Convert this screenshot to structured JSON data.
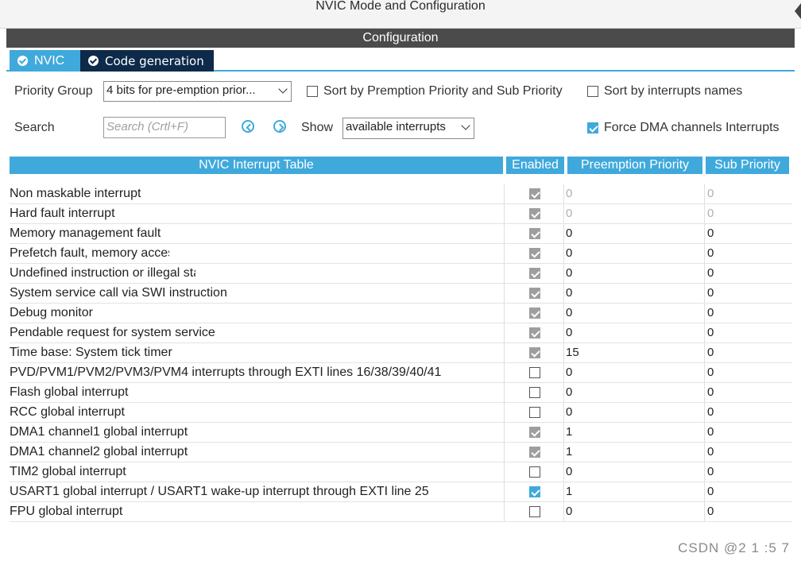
{
  "window": {
    "title": "NVIC Mode and Configuration"
  },
  "config_header": "Configuration",
  "tabs": [
    {
      "label": "NVIC",
      "active": true
    },
    {
      "label": "Code generation",
      "active": false
    }
  ],
  "toolbar": {
    "priority_group_label": "Priority Group",
    "priority_group_value": "4 bits for pre-emption prior...",
    "sort_premption_label": "Sort by Premption Priority and Sub Priority",
    "sort_premption_checked": false,
    "sort_names_label": "Sort by interrupts names",
    "sort_names_checked": false,
    "search_label": "Search",
    "search_placeholder": "Search (Crtl+F)",
    "show_label": "Show",
    "show_value": "available interrupts",
    "force_dma_label": "Force DMA channels Interrupts",
    "force_dma_checked": true
  },
  "table": {
    "headers": [
      "NVIC Interrupt Table",
      "Enabled",
      "Preemption Priority",
      "Sub Priority"
    ],
    "rows": [
      {
        "name": "Non maskable interrupt",
        "enabled": true,
        "locked": true,
        "preemption": "0",
        "sub": "0",
        "dim": true
      },
      {
        "name": "Hard fault interrupt",
        "enabled": true,
        "locked": true,
        "preemption": "0",
        "sub": "0",
        "dim": true
      },
      {
        "name": "Memory management fault",
        "enabled": true,
        "locked": true,
        "preemption": "0",
        "sub": "0",
        "dim": false
      },
      {
        "name": "Prefetch fault, memory access fault",
        "enabled": true,
        "locked": true,
        "preemption": "0",
        "sub": "0",
        "dim": false
      },
      {
        "name": "Undefined instruction or illegal state",
        "enabled": true,
        "locked": true,
        "preemption": "0",
        "sub": "0",
        "dim": false
      },
      {
        "name": "System service call via SWI instruction",
        "enabled": true,
        "locked": true,
        "preemption": "0",
        "sub": "0",
        "dim": false
      },
      {
        "name": "Debug monitor",
        "enabled": true,
        "locked": true,
        "preemption": "0",
        "sub": "0",
        "dim": false
      },
      {
        "name": "Pendable request for system service",
        "enabled": true,
        "locked": true,
        "preemption": "0",
        "sub": "0",
        "dim": false
      },
      {
        "name": "Time base: System tick timer",
        "enabled": true,
        "locked": true,
        "preemption": "15",
        "sub": "0",
        "dim": false
      },
      {
        "name": "PVD/PVM1/PVM2/PVM3/PVM4 interrupts through EXTI lines 16/38/39/40/41",
        "enabled": false,
        "locked": false,
        "preemption": "0",
        "sub": "0",
        "dim": false
      },
      {
        "name": "Flash global interrupt",
        "enabled": false,
        "locked": false,
        "preemption": "0",
        "sub": "0",
        "dim": false
      },
      {
        "name": "RCC global interrupt",
        "enabled": false,
        "locked": false,
        "preemption": "0",
        "sub": "0",
        "dim": false
      },
      {
        "name": "DMA1 channel1 global interrupt",
        "enabled": true,
        "locked": true,
        "preemption": "1",
        "sub": "0",
        "dim": false
      },
      {
        "name": "DMA1 channel2 global interrupt",
        "enabled": true,
        "locked": true,
        "preemption": "1",
        "sub": "0",
        "dim": false
      },
      {
        "name": "TIM2 global interrupt",
        "enabled": false,
        "locked": false,
        "preemption": "0",
        "sub": "0",
        "dim": false
      },
      {
        "name": "USART1 global interrupt / USART1 wake-up interrupt through EXTI line 25",
        "enabled": true,
        "locked": false,
        "preemption": "1",
        "sub": "0",
        "dim": false
      },
      {
        "name": "FPU global interrupt",
        "enabled": false,
        "locked": false,
        "preemption": "0",
        "sub": "0",
        "dim": false
      }
    ]
  },
  "watermark": "CSDN @2 1 :5 7",
  "colors": {
    "accent": "#3fa9dc",
    "dark_tab": "#0d2a4a",
    "header_bar": "#4b4b4b"
  }
}
